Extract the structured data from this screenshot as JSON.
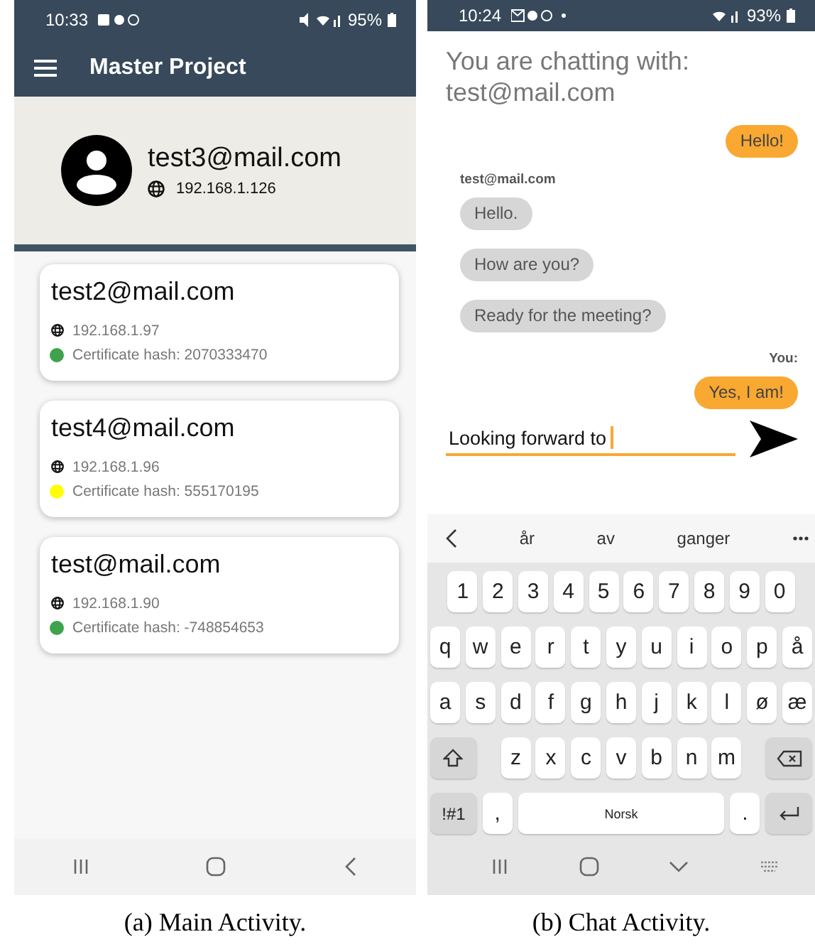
{
  "main_activity": {
    "status_bar": {
      "time": "10:33",
      "battery": "95%"
    },
    "app_bar": {
      "title": "Master Project"
    },
    "profile": {
      "email": "test3@mail.com",
      "ip": "192.168.1.126"
    },
    "peers": [
      {
        "email": "test2@mail.com",
        "ip": "192.168.1.97",
        "hash": "Certificate hash: 2070333470",
        "color": "#3fa34d"
      },
      {
        "email": "test4@mail.com",
        "ip": "192.168.1.96",
        "hash": "Certificate hash: 555170195",
        "color": "#ffff00"
      },
      {
        "email": "test@mail.com",
        "ip": "192.168.1.90",
        "hash": "Certificate hash: -748854653",
        "color": "#3fa34d"
      }
    ],
    "caption": "(a) Main Activity."
  },
  "chat_activity": {
    "status_bar": {
      "time": "10:24",
      "battery": "93%"
    },
    "heading": [
      "You are chatting with:",
      "test@mail.com"
    ],
    "messages": [
      {
        "kind": "sent",
        "text": "Hello!"
      },
      {
        "kind": "peer_label",
        "text": "test@mail.com"
      },
      {
        "kind": "received",
        "text": "Hello."
      },
      {
        "kind": "received",
        "text": "How are you?"
      },
      {
        "kind": "received",
        "text": "Ready for the meeting?"
      },
      {
        "kind": "own_label",
        "text": "You:"
      },
      {
        "kind": "sent",
        "text": "Yes, I am!"
      }
    ],
    "input": {
      "value": "Looking forward to"
    },
    "suggestions": [
      "år",
      "av",
      "ganger"
    ],
    "keyboard": [
      [
        {
          "kind": "char",
          "label": "1"
        },
        {
          "kind": "char",
          "label": "2"
        },
        {
          "kind": "char",
          "label": "3"
        },
        {
          "kind": "char",
          "label": "4"
        },
        {
          "kind": "char",
          "label": "5"
        },
        {
          "kind": "char",
          "label": "6"
        },
        {
          "kind": "char",
          "label": "7"
        },
        {
          "kind": "char",
          "label": "8"
        },
        {
          "kind": "char",
          "label": "9"
        },
        {
          "kind": "char",
          "label": "0"
        }
      ],
      [
        {
          "kind": "char",
          "label": "q"
        },
        {
          "kind": "char",
          "label": "w"
        },
        {
          "kind": "char",
          "label": "e"
        },
        {
          "kind": "char",
          "label": "r"
        },
        {
          "kind": "char",
          "label": "t"
        },
        {
          "kind": "char",
          "label": "y"
        },
        {
          "kind": "char",
          "label": "u"
        },
        {
          "kind": "char",
          "label": "i"
        },
        {
          "kind": "char",
          "label": "o"
        },
        {
          "kind": "char",
          "label": "p"
        },
        {
          "kind": "char",
          "label": "å"
        }
      ],
      [
        {
          "kind": "char",
          "label": "a"
        },
        {
          "kind": "char",
          "label": "s"
        },
        {
          "kind": "char",
          "label": "d"
        },
        {
          "kind": "char",
          "label": "f"
        },
        {
          "kind": "char",
          "label": "g"
        },
        {
          "kind": "char",
          "label": "h"
        },
        {
          "kind": "char",
          "label": "j"
        },
        {
          "kind": "char",
          "label": "k"
        },
        {
          "kind": "char",
          "label": "l"
        },
        {
          "kind": "char",
          "label": "ø"
        },
        {
          "kind": "char",
          "label": "æ"
        }
      ],
      [
        {
          "kind": "shift"
        },
        {
          "kind": "char",
          "label": "z"
        },
        {
          "kind": "char",
          "label": "x"
        },
        {
          "kind": "char",
          "label": "c"
        },
        {
          "kind": "char",
          "label": "v"
        },
        {
          "kind": "char",
          "label": "b"
        },
        {
          "kind": "char",
          "label": "n"
        },
        {
          "kind": "char",
          "label": "m"
        },
        {
          "kind": "backspace"
        }
      ],
      [
        {
          "kind": "function",
          "label": "!#1"
        },
        {
          "kind": "char",
          "label": ","
        },
        {
          "kind": "space",
          "label": "Norsk"
        },
        {
          "kind": "char",
          "label": "."
        },
        {
          "kind": "enter"
        }
      ]
    ],
    "caption": "(b) Chat Activity."
  }
}
